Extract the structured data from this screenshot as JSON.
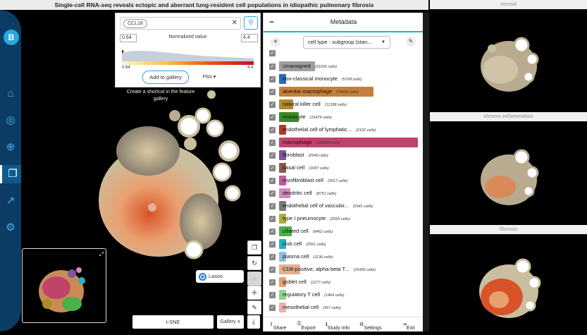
{
  "title": "Single-cell RNA-seq reveals ectopic and aberrant lung-resident cell populations in idiopathic pulmonary fibrosis",
  "sidebar": {
    "logo": "B",
    "items": [
      {
        "icon": "home-icon",
        "glyph": "⌂"
      },
      {
        "icon": "explore-icon",
        "glyph": "◎"
      },
      {
        "icon": "add-icon",
        "glyph": "⊕"
      },
      {
        "icon": "gallery-icon",
        "glyph": "❐"
      },
      {
        "icon": "share-icon",
        "glyph": "↗"
      },
      {
        "icon": "settings-icon",
        "glyph": "⚙"
      }
    ],
    "active_index": 3
  },
  "feature": {
    "gene": "CCL18",
    "min": "0.64",
    "max": "4.4",
    "label": "Normalized value",
    "scale_min": "0.64",
    "scale_max": "4.4",
    "add_gallery": "Add to gallery",
    "plot": "Plot ▾",
    "tooltip": "Create a shortcut in the feature gallery"
  },
  "tools": {
    "lasso": "Lasso",
    "embedding": "t-SNE",
    "gallery": "Gallery ∧"
  },
  "metadata": {
    "header": "Metadata",
    "subgroup": "cell type - subgroup (stan...",
    "categories": [
      {
        "name": "Unassigned",
        "count": "(31026 cells)",
        "color": "#9e9e9e",
        "bar": 0.26
      },
      {
        "name": "non-classical monocyte",
        "count": "(5708 cells)",
        "color": "#2b6cb0",
        "bar": 0.05
      },
      {
        "name": "alveolar macrophage",
        "count": "(74558 cells)",
        "color": "#c47f3a",
        "bar": 0.68
      },
      {
        "name": "natural killer cell",
        "count": "(11338 cells)",
        "color": "#b08a2a",
        "bar": 0.1
      },
      {
        "name": "monocyte",
        "count": "(15476 cells)",
        "color": "#3a8a2a",
        "bar": 0.14
      },
      {
        "name": "endothelial cell of lymphatic...",
        "count": "(2102 cells)",
        "color": "#b63a2a",
        "bar": 0.04
      },
      {
        "name": "macrophage",
        "count": "(108994 cells)",
        "color": "#c0436a",
        "bar": 1.0
      },
      {
        "name": "fibroblast",
        "count": "(2649 cells)",
        "color": "#7a5a9a",
        "bar": 0.04
      },
      {
        "name": "basal cell",
        "count": "(1687 cells)",
        "color": "#8a5a4a",
        "bar": 0.04
      },
      {
        "name": "myofibroblast cell",
        "count": "(3517 cells)",
        "color": "#c05a9a",
        "bar": 0.04
      },
      {
        "name": "dendritic cell",
        "count": "(8751 cells)",
        "color": "#d08ac0",
        "bar": 0.08
      },
      {
        "name": "endothelial cell of vascular...",
        "count": "(5341 cells)",
        "color": "#7a7a7a",
        "bar": 0.05
      },
      {
        "name": "type I pneumocyte",
        "count": "(2525 cells)",
        "color": "#b0b03a",
        "bar": 0.04
      },
      {
        "name": "ciliated cell",
        "count": "(9462 cells)",
        "color": "#4ab04a",
        "bar": 0.09
      },
      {
        "name": "club cell",
        "count": "(2551 cells)",
        "color": "#2ab0c0",
        "bar": 0.04
      },
      {
        "name": "plasma cell",
        "count": "(1136 cells)",
        "color": "#8ac0e0",
        "bar": 0.04
      },
      {
        "name": "CD8-positive, alpha-beta T...",
        "count": "(16396 cells)",
        "color": "#e0b090",
        "bar": 0.15
      },
      {
        "name": "goblet cell",
        "count": "(1277 cells)",
        "color": "#e0a070",
        "bar": 0.04
      },
      {
        "name": "regulatory T cell",
        "count": "(1464 cells)",
        "color": "#90d090",
        "bar": 0.04
      },
      {
        "name": "mesothelial cell",
        "count": "(567 cells)",
        "color": "#e8b0b0",
        "bar": 0.04
      }
    ],
    "footer": {
      "share": "Share",
      "export": "Export",
      "study_info": "Study Info",
      "settings": "Settings",
      "exit": "Exit"
    }
  },
  "comparison": [
    {
      "label": "normal"
    },
    {
      "label": "chronic inflammation"
    },
    {
      "label": "fibrosis"
    }
  ]
}
